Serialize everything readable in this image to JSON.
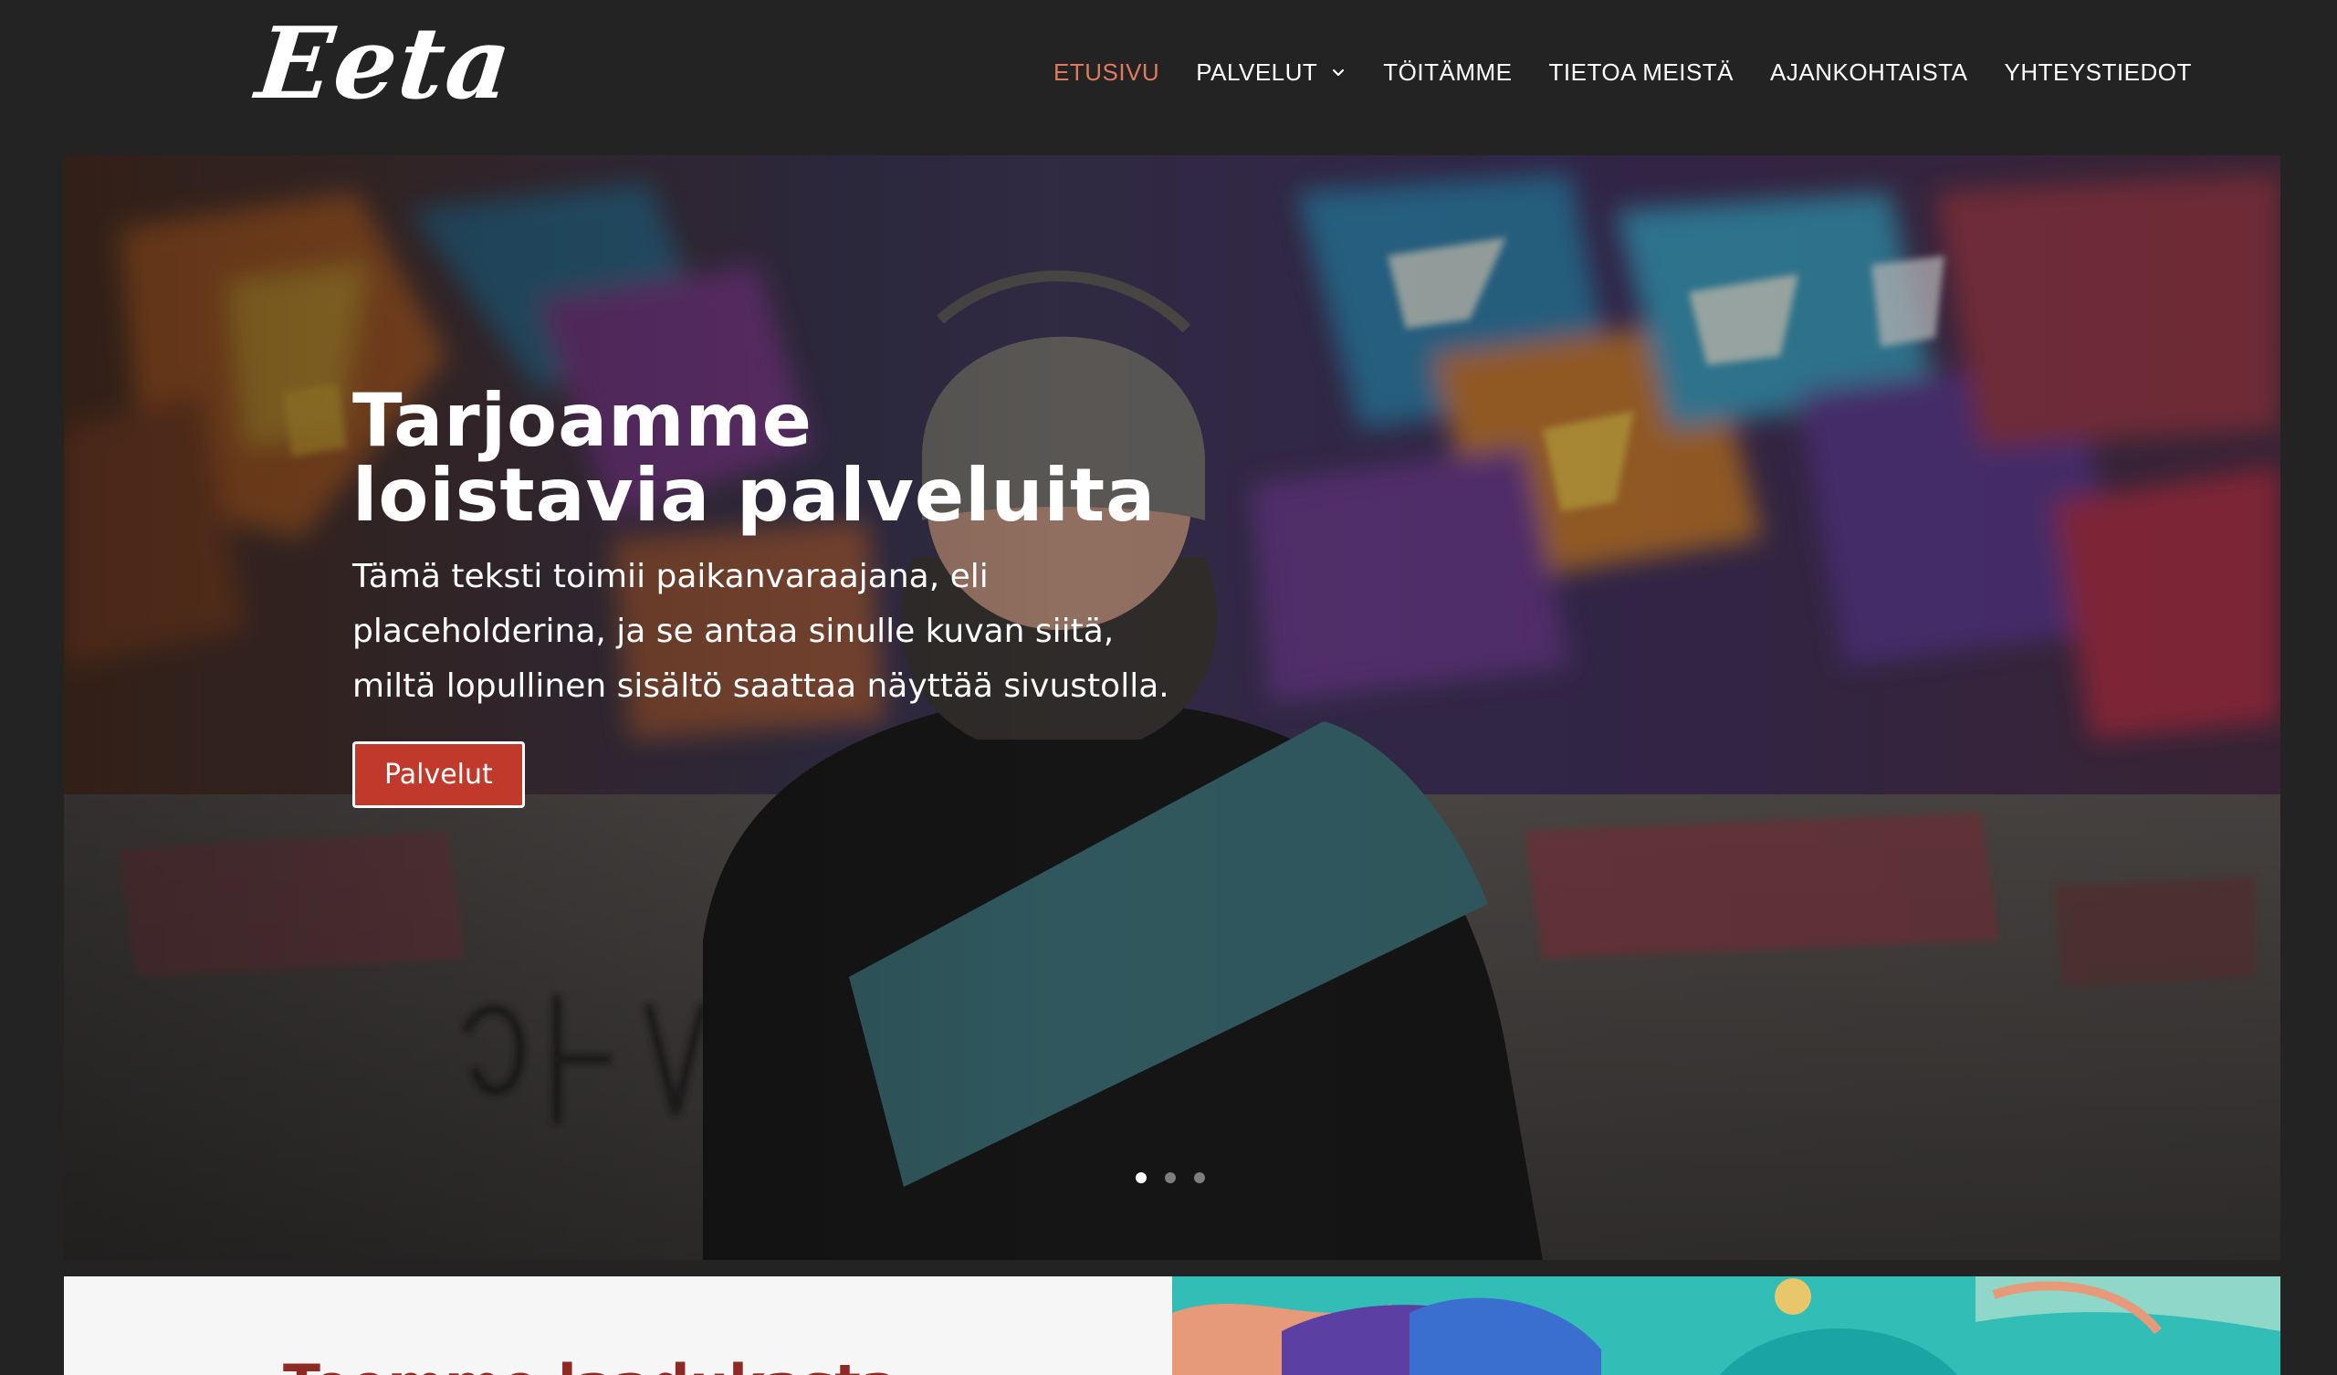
{
  "header": {
    "logo_text": "Eeta",
    "nav": [
      {
        "label": "ETUSIVU",
        "active": true
      },
      {
        "label": "PALVELUT",
        "has_dropdown": true
      },
      {
        "label": "TÖITÄMME"
      },
      {
        "label": "TIETOA MEISTÄ"
      },
      {
        "label": "AJANKOHTAISTA"
      },
      {
        "label": "YHTEYSTIEDOT"
      }
    ],
    "active_color": "#e07a5f"
  },
  "hero": {
    "title_line1": "Tarjoamme",
    "title_line2": "loistavia palveluita",
    "text": "Tämä teksti toimii paikanvaraajana, eli placeholderina, ja se antaa sinulle kuvan siitä, miltä lopullinen sisältö saattaa näyttää sivustolla.",
    "button_label": "Palvelut",
    "button_color": "#c0392b",
    "slides_total": 3,
    "active_slide": 1
  },
  "section": {
    "heading_partial": "Teemme laadukasta"
  }
}
